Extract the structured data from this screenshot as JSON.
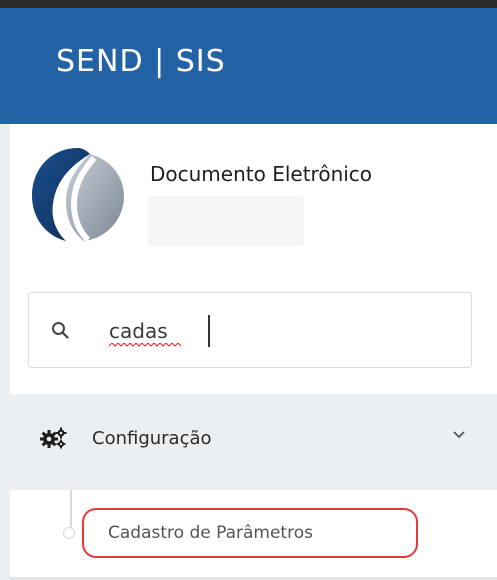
{
  "header": {
    "app_title": "SEND | SIS"
  },
  "profile": {
    "title": "Documento Eletrônico"
  },
  "search": {
    "value": "cadas",
    "icon": "search-icon"
  },
  "menu": {
    "section_label": "Configuração",
    "section_icon": "gears-icon",
    "expand_icon": "chevron-down-icon",
    "items": [
      {
        "label": "Cadastro de Parâmetros"
      }
    ]
  },
  "colors": {
    "header_bg": "#2363a5",
    "highlight_border": "#e5393a",
    "menu_bg": "#eceff1"
  }
}
